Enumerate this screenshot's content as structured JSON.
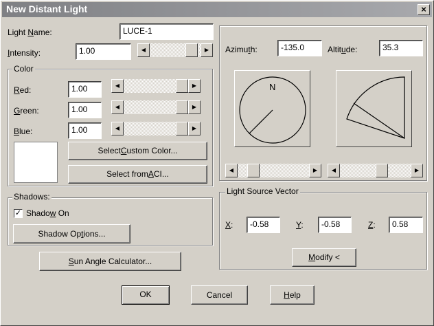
{
  "window": {
    "title": "New Distant Light",
    "close_glyph": "×"
  },
  "light_name": {
    "label_pre": "Light ",
    "label_u": "N",
    "label_post": "ame:",
    "value": "LUCE-1"
  },
  "intensity": {
    "label_pre": "",
    "label_u": "I",
    "label_post": "ntensity:",
    "value": "1.00",
    "level": 0.9
  },
  "color": {
    "title": "Color",
    "red": {
      "label_u": "R",
      "label_post": "ed:",
      "value": "1.00"
    },
    "green": {
      "label_u": "G",
      "label_post": "reen:",
      "value": "1.00"
    },
    "blue": {
      "label_u": "B",
      "label_post": "lue:",
      "value": "1.00"
    },
    "swatch": "#ffffff",
    "custom_btn": {
      "pre": "Select ",
      "u": "C",
      "post": "ustom Color..."
    },
    "aci_btn": {
      "pre": "Select from ",
      "u": "A",
      "post": "CI..."
    }
  },
  "shadows": {
    "title": "Shadows:",
    "checkbox": {
      "checked": true,
      "glyph": "✓",
      "pre": "Shado",
      "u": "w",
      "post": " On"
    },
    "options_btn": {
      "pre": "Shadow Op",
      "u": "t",
      "post": "ions..."
    }
  },
  "sun_angle_btn": {
    "pre": "",
    "u": "S",
    "post": "un Angle Calculator..."
  },
  "azimuth": {
    "label_pre": "Azimu",
    "label_u": "t",
    "label_post": "h:",
    "value": "-135.0",
    "compass_label": "N"
  },
  "altitude": {
    "label_pre": "Altit",
    "label_u": "u",
    "label_post": "de:",
    "value": "35.3"
  },
  "vector": {
    "title": "Light Source Vector",
    "x": {
      "label_u": "X",
      "label_post": ":",
      "value": "-0.58"
    },
    "y": {
      "label_u": "Y",
      "label_post": ":",
      "value": "-0.58"
    },
    "z": {
      "label_u": "Z",
      "label_post": ":",
      "value": "0.58"
    },
    "modify_btn": {
      "pre": "",
      "u": "M",
      "post": "odify <"
    }
  },
  "footer": {
    "ok": "OK",
    "cancel": "Cancel",
    "help": {
      "pre": "",
      "u": "H",
      "post": "elp"
    }
  },
  "arrows": {
    "left": "◀",
    "right": "▶"
  }
}
